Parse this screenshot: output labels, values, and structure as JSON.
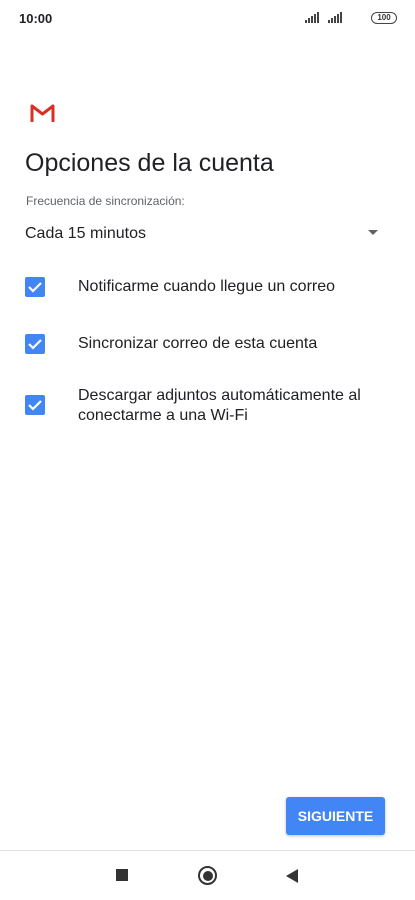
{
  "status": {
    "time": "10:00",
    "battery": "100"
  },
  "header": {
    "title": "Opciones de la cuenta"
  },
  "sync": {
    "label": "Frecuencia de sincronización:",
    "value": "Cada 15 minutos"
  },
  "options": [
    {
      "label": "Notificarme cuando llegue un correo",
      "checked": true
    },
    {
      "label": "Sincronizar correo de esta cuenta",
      "checked": true
    },
    {
      "label": "Descargar adjuntos automáticamente al conectarme a una Wi-Fi",
      "checked": true
    }
  ],
  "actions": {
    "next_label": "SIGUIENTE"
  },
  "colors": {
    "accent": "#4285f4",
    "gmail_red": "#d93025"
  },
  "icons": {
    "logo": "gmail-icon",
    "checkbox": "checkbox-checked-icon",
    "dropdown": "dropdown-arrow-icon",
    "nav": [
      "recent-apps-icon",
      "home-icon",
      "back-icon"
    ]
  }
}
